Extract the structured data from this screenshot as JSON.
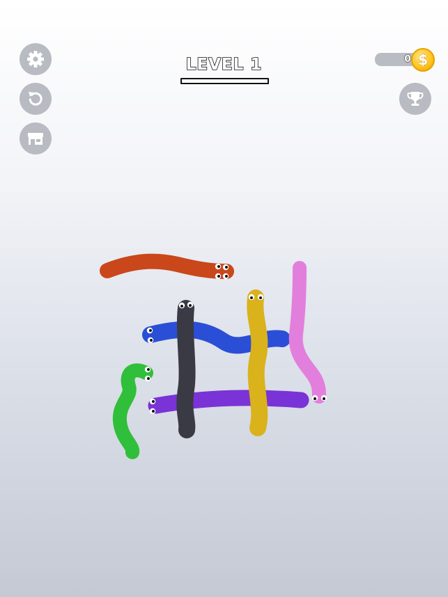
{
  "header": {
    "level_label": "LEVEL 1",
    "coins": "0",
    "coin_symbol": "$"
  },
  "left_buttons": [
    {
      "name": "settings-button",
      "icon": "gear-icon"
    },
    {
      "name": "restart-button",
      "icon": "restart-icon"
    },
    {
      "name": "shop-button",
      "icon": "shop-icon"
    }
  ],
  "right_buttons": [
    {
      "name": "trophy-button",
      "icon": "trophy-icon"
    }
  ],
  "snakes": [
    {
      "id": "orange",
      "color": "#c9471a"
    },
    {
      "id": "blue",
      "color": "#2a4fd6"
    },
    {
      "id": "black",
      "color": "#3a3a44"
    },
    {
      "id": "yellow",
      "color": "#d9b21c"
    },
    {
      "id": "pink",
      "color": "#e27fdc"
    },
    {
      "id": "green",
      "color": "#2fbf3a"
    },
    {
      "id": "purple",
      "color": "#7a33d6"
    }
  ]
}
